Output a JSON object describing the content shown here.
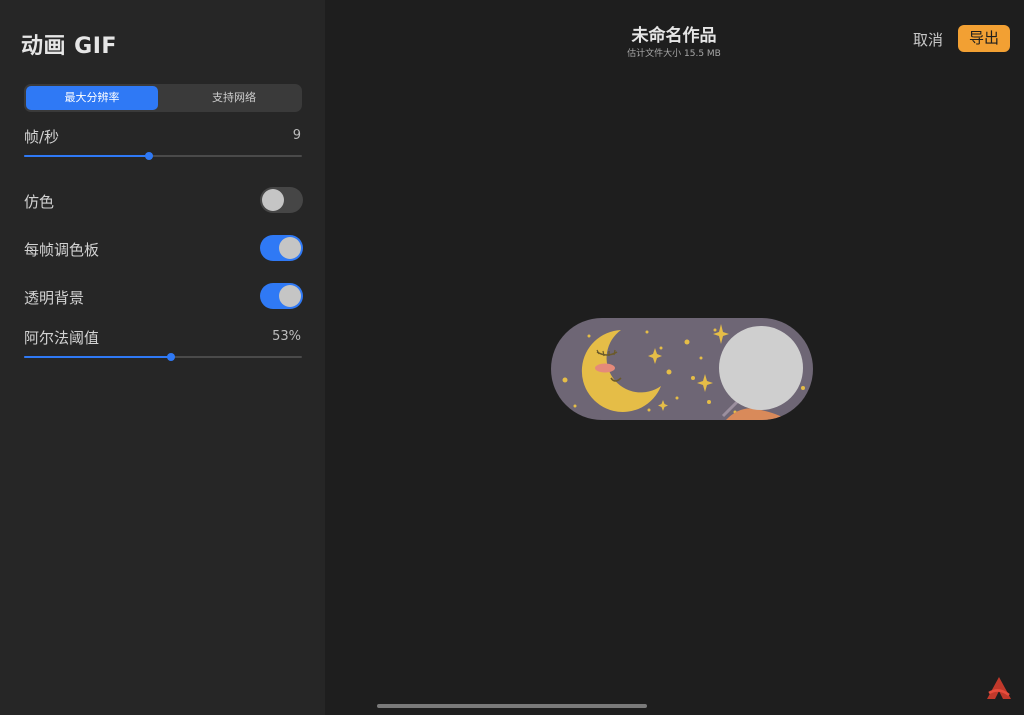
{
  "sidebar": {
    "title": "动画 GIF",
    "segments": [
      "最大分辨率",
      "支持网络"
    ],
    "fps": {
      "label": "帧/秒",
      "value": "9",
      "fraction": 0.45
    },
    "dither": {
      "label": "仿色",
      "on": false
    },
    "palette_per_frame": {
      "label": "每帧调色板",
      "on": true
    },
    "transparent_bg": {
      "label": "透明背景",
      "on": true
    },
    "alpha_threshold": {
      "label": "阿尔法阈值",
      "value": "53%",
      "fraction": 0.53
    }
  },
  "header": {
    "title": "未命名作品",
    "subtitle": "估计文件大小 15.5 MB",
    "cancel_label": "取消",
    "export_label": "导出"
  },
  "icons": {
    "logo": "procreate-logo-icon"
  },
  "colors": {
    "accent": "#2f79f5",
    "export": "#f2a033",
    "preview_bg": "#6e6675",
    "moon": "#e5bd47"
  }
}
